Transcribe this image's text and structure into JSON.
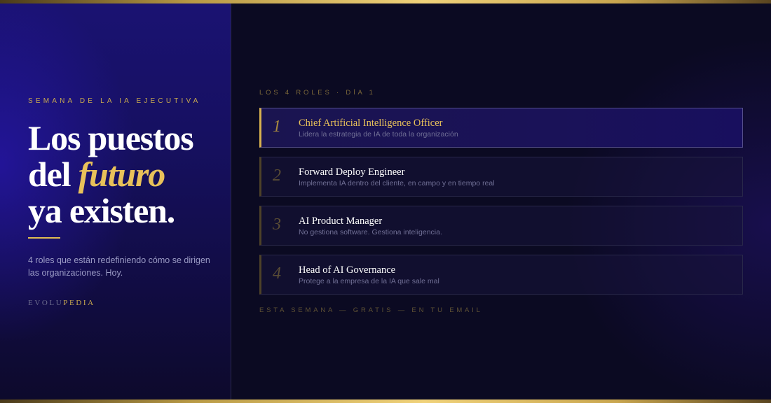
{
  "left": {
    "eyebrow": "SEMANA DE LA IA EJECUTIVA",
    "headline": {
      "line1": "Los puestos",
      "line2_prefix": "del ",
      "line2_accent": "futuro",
      "line3": "ya existen."
    },
    "lede": "4 roles que están redefiniendo cómo se dirigen las organizaciones. Hoy.",
    "brand": {
      "part1": "EVOLU",
      "part2": "PEDIA"
    }
  },
  "right": {
    "eyebrow": "LOS 4 ROLES · DÍA 1",
    "roles": [
      {
        "number": "1",
        "title": "Chief Artificial Intelligence Officer",
        "description": "Lidera la estrategia de IA de toda la organización"
      },
      {
        "number": "2",
        "title": "Forward Deploy Engineer",
        "description": "Implementa IA dentro del cliente, en campo y en tiempo real"
      },
      {
        "number": "3",
        "title": "AI Product Manager",
        "description": "No gestiona software. Gestiona inteligencia."
      },
      {
        "number": "4",
        "title": "Head of AI Governance",
        "description": "Protege a la empresa de la IA que sale mal"
      }
    ],
    "footer": "ESTA SEMANA — GRATIS — EN TU EMAIL"
  },
  "colors": {
    "accent_gold": "#e8c15a",
    "background": "#0b0a22",
    "panel_indigo": "#1a1272"
  }
}
